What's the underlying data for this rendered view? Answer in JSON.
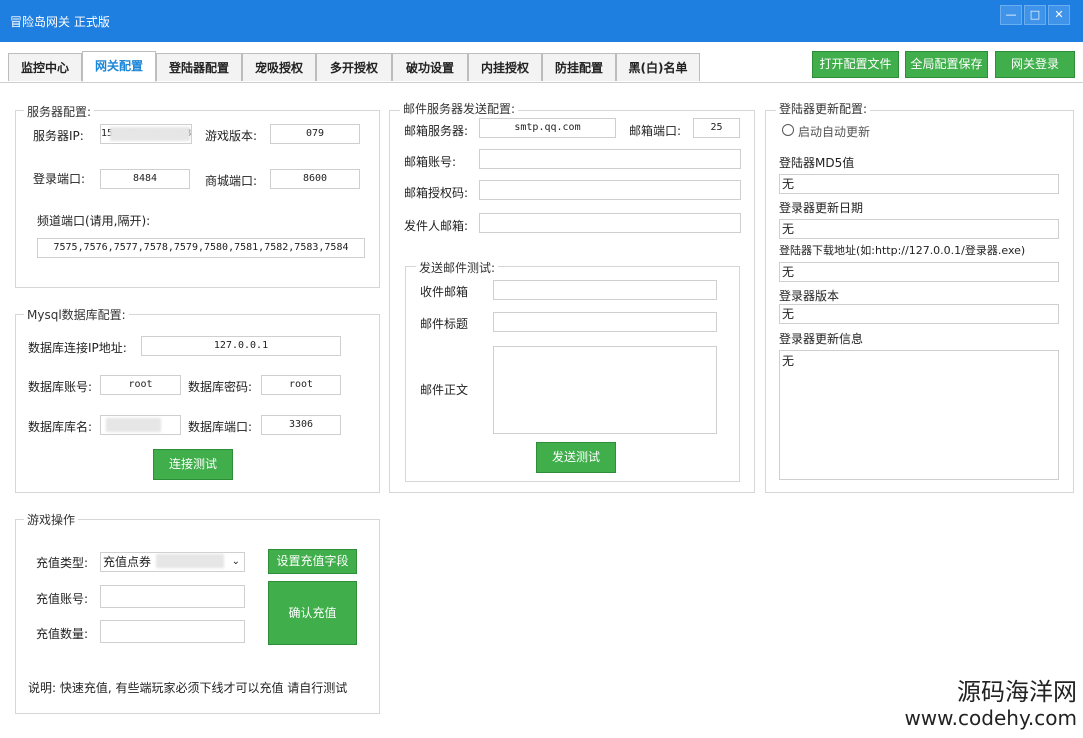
{
  "window": {
    "title": "冒险岛网关 正式版",
    "min": "—",
    "max": "□",
    "close": "✕"
  },
  "tabs": [
    "监控中心",
    "网关配置",
    "登陆器配置",
    "宠吸授权",
    "多开授权",
    "破功设置",
    "内挂授权",
    "防挂配置",
    "黑(白)名单"
  ],
  "actions": {
    "open_config": "打开配置文件",
    "save_all": "全局配置保存",
    "gateway_login": "网关登录"
  },
  "server": {
    "title": "服务器配置:",
    "ip_label": "服务器IP:",
    "ip_value": "153.159.192.218",
    "version_label": "游戏版本:",
    "version_value": "079",
    "login_port_label": "登录端口:",
    "login_port_value": "8484",
    "shop_port_label": "商城端口:",
    "shop_port_value": "8600",
    "channel_label": "频道端口(请用,隔开):",
    "channel_value": "7575,7576,7577,7578,7579,7580,7581,7582,7583,7584"
  },
  "mysql": {
    "title": "Mysql数据库配置:",
    "ip_label": "数据库连接IP地址:",
    "ip_value": "127.0.0.1",
    "user_label": "数据库账号:",
    "user_value": "root",
    "pass_label": "数据库密码:",
    "pass_value": "root",
    "db_label": "数据库库名:",
    "port_label": "数据库端口:",
    "port_value": "3306",
    "test_button": "连接测试"
  },
  "game": {
    "title": "游戏操作",
    "type_label": "充值类型:",
    "type_value": "充值点券",
    "set_field_button": "设置充值字段",
    "account_label": "充值账号:",
    "amount_label": "充值数量:",
    "confirm_button": "确认充值",
    "note": "说明: 快速充值, 有些端玩家必须下线才可以充值 请自行测试"
  },
  "mail": {
    "title": "邮件服务器发送配置:",
    "server_label": "邮箱服务器:",
    "server_value": "smtp.qq.com",
    "port_label": "邮箱端口:",
    "port_value": "25",
    "account_label": "邮箱账号:",
    "auth_label": "邮箱授权码:",
    "sender_label": "发件人邮箱:",
    "test_title": "发送邮件测试:",
    "recv_label": "收件邮箱",
    "subject_label": "邮件标题",
    "body_label": "邮件正文",
    "send_button": "发送测试"
  },
  "launcher": {
    "title": "登陆器更新配置:",
    "auto_update": "启动自动更新",
    "md5_label": "登陆器MD5值",
    "md5_value": "无",
    "date_label": "登录器更新日期",
    "date_value": "无",
    "url_label": "登陆器下载地址(如:http://127.0.0.1/登录器.exe)",
    "url_value": "无",
    "version_label": "登录器版本",
    "version_value": "无",
    "info_label": "登录器更新信息",
    "info_value": "无"
  },
  "watermark": {
    "line1": "源码海洋网",
    "line2": "www.codehy.com"
  }
}
